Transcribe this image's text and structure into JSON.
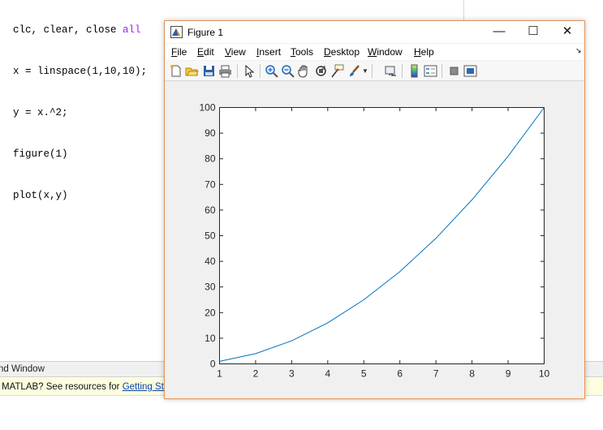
{
  "editor": {
    "lines": [
      {
        "pre": "clc, clear, close ",
        "kw": "all"
      },
      {
        "pre": "x = linspace(1,10,10);",
        "kw": ""
      },
      {
        "pre": "y = x.^2;",
        "kw": ""
      },
      {
        "pre": "figure(1)",
        "kw": ""
      },
      {
        "pre": "plot(x,y)",
        "kw": ""
      }
    ]
  },
  "command_window": {
    "title": "nd Window",
    "banner_text": "MATLAB? See resources for ",
    "banner_link": "Getting Starte"
  },
  "figure": {
    "title": "Figure 1",
    "window_buttons": {
      "minimize": "—",
      "maximize": "☐",
      "close": "✕"
    },
    "menus": [
      {
        "key": "F",
        "rest": "ile"
      },
      {
        "key": "E",
        "rest": "dit"
      },
      {
        "key": "V",
        "rest": "iew"
      },
      {
        "key": "I",
        "rest": "nsert"
      },
      {
        "key": "T",
        "rest": "ools"
      },
      {
        "key": "D",
        "rest": "esktop"
      },
      {
        "key": "W",
        "rest": "indow"
      },
      {
        "key": "H",
        "rest": "elp"
      }
    ],
    "toolbar_icons": [
      "new-figure-icon",
      "open-file-icon",
      "save-icon",
      "print-icon",
      "pointer-icon",
      "zoom-in-icon",
      "zoom-out-icon",
      "pan-icon",
      "rotate-3d-icon",
      "data-cursor-icon",
      "brush-icon",
      "brush-dropdown-icon",
      "link-plot-icon",
      "colorbar-icon",
      "legend-icon",
      "hide-plot-tools-icon",
      "show-plot-tools-icon"
    ]
  },
  "chart_data": {
    "type": "line",
    "title": "",
    "xlabel": "",
    "ylabel": "",
    "xlim": [
      1,
      10
    ],
    "ylim": [
      0,
      100
    ],
    "x_ticks": [
      1,
      2,
      3,
      4,
      5,
      6,
      7,
      8,
      9,
      10
    ],
    "y_ticks": [
      0,
      10,
      20,
      30,
      40,
      50,
      60,
      70,
      80,
      90,
      100
    ],
    "grid": false,
    "series": [
      {
        "color": "#0072bd",
        "x": [
          1,
          2,
          3,
          4,
          5,
          6,
          7,
          8,
          9,
          10
        ],
        "y": [
          1,
          4,
          9,
          16,
          25,
          36,
          49,
          64,
          81,
          100
        ]
      }
    ]
  }
}
